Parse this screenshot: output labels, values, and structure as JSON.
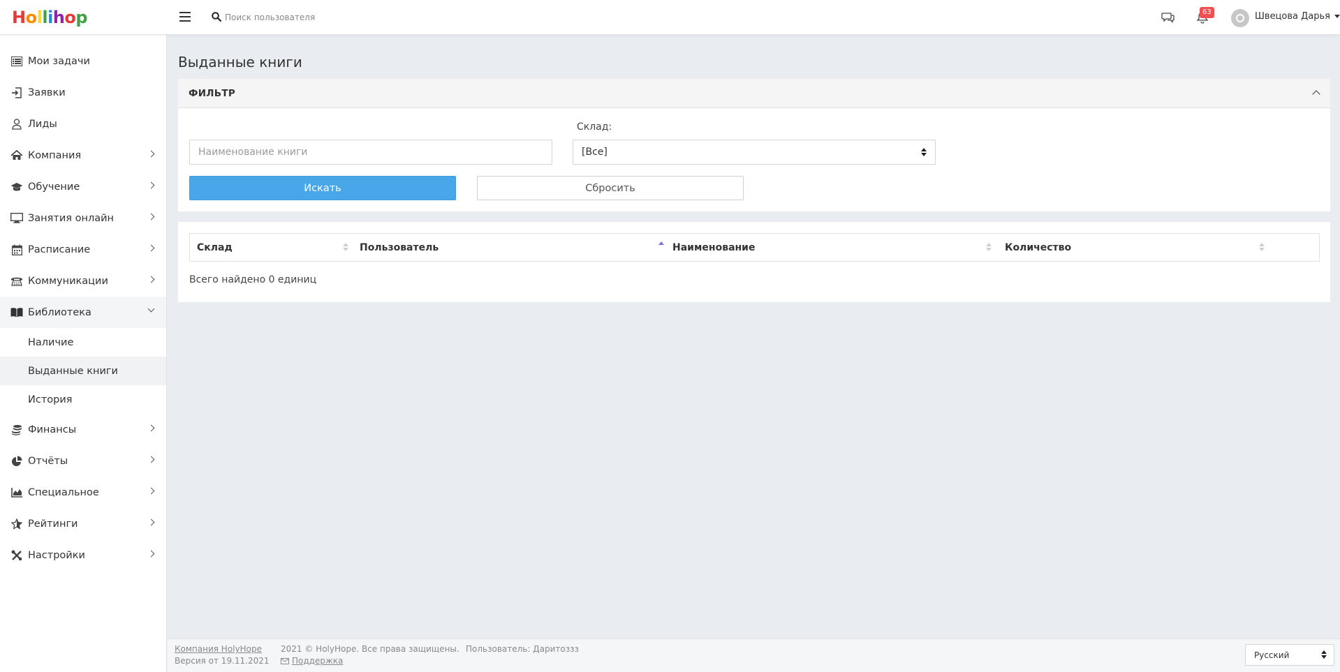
{
  "app": {
    "logo_letters": [
      "H",
      "o",
      "l",
      "l",
      "i",
      "h",
      "o",
      "p"
    ]
  },
  "header": {
    "search_placeholder": "Поиск пользователя",
    "notifications_count": "63",
    "user_name": "Швецова Дарья"
  },
  "sidebar": {
    "items": [
      {
        "label": "Мои задачи",
        "icon": "tasks-icon"
      },
      {
        "label": "Заявки",
        "icon": "sign-in-icon"
      },
      {
        "label": "Лиды",
        "icon": "user-icon"
      },
      {
        "label": "Компания",
        "icon": "home-icon"
      },
      {
        "label": "Обучение",
        "icon": "graduation-cap-icon"
      },
      {
        "label": "Занятия онлайн",
        "icon": "monitor-icon"
      },
      {
        "label": "Расписание",
        "icon": "calendar-icon"
      },
      {
        "label": "Коммуникации",
        "icon": "phone-icon"
      },
      {
        "label": "Библиотека",
        "icon": "book-icon"
      },
      {
        "label": "Финансы",
        "icon": "coins-icon"
      },
      {
        "label": "Отчёты",
        "icon": "pie-chart-icon"
      },
      {
        "label": "Специальное",
        "icon": "area-chart-icon"
      },
      {
        "label": "Рейтинги",
        "icon": "star-icon"
      },
      {
        "label": "Настройки",
        "icon": "tools-icon"
      }
    ],
    "library_sub": [
      {
        "label": "Наличие"
      },
      {
        "label": "Выданные книги"
      },
      {
        "label": "История"
      }
    ]
  },
  "main": {
    "title": "Выданные книги",
    "filter": {
      "title": "ФИЛЬТР",
      "book_placeholder": "Наименование книги",
      "stock_label": "Склад:",
      "stock_value": "[Все]",
      "search_label": "Искать",
      "reset_label": "Сбросить"
    },
    "table": {
      "columns": [
        "Склад",
        "Пользователь",
        "Наименование",
        "Количество"
      ],
      "total": "Всего найдено 0 единиц"
    }
  },
  "footer": {
    "company": "Компания HolyHope",
    "version": "Версия от 19.11.2021",
    "copyright": "2021 © HolyHope. Все права защищены.",
    "support": "Поддержка",
    "user": "Пользователь: Даритоззз",
    "language": "Русский"
  },
  "colors": {
    "primary_button": "#49a7e9",
    "badge": "#f05050",
    "sort_active": "#7e6de0",
    "background": "#e9ecf0"
  }
}
